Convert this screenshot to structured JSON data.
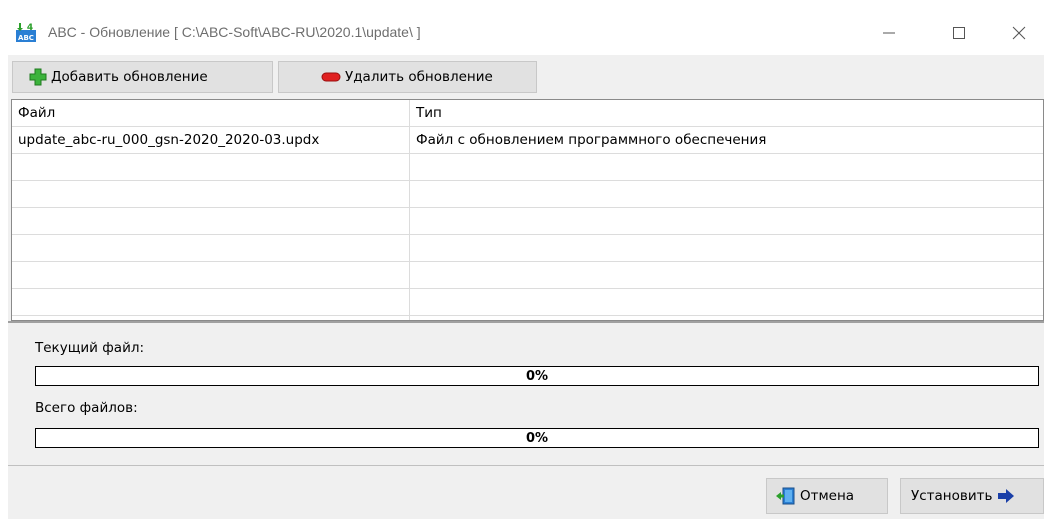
{
  "window": {
    "title": "ABC - Обновление [ C:\\ABC-Soft\\ABC-RU\\2020.1\\update\\ ]",
    "controls": {
      "minimize": "minimize-icon",
      "maximize": "maximize-icon",
      "close": "close-icon"
    }
  },
  "toolbar": {
    "add_label": "Добавить обновление",
    "add_icon": "plus-icon",
    "delete_label": "Удалить обновление",
    "delete_icon": "minus-icon"
  },
  "table": {
    "columns": [
      "Файл",
      "Тип"
    ],
    "rows": [
      [
        "update_abc-ru_000_gsn-2020_2020-03.updx",
        "Файл с обновлением программного обеспечения"
      ]
    ]
  },
  "progress": {
    "current_label": "Текущий файл:",
    "current_value": "0%",
    "current_fraction": 0,
    "total_label": "Всего файлов:",
    "total_value": "0%",
    "total_fraction": 0,
    "fill_color": "#3c9a3c"
  },
  "footer": {
    "cancel_label": "Отмена",
    "cancel_icon": "exit-door-icon",
    "install_label": "Установить",
    "install_icon": "arrow-right-icon"
  },
  "colors": {
    "add_icon": "#2ca02c",
    "delete_icon": "#d62020",
    "install_arrow": "#1a3fa8"
  }
}
